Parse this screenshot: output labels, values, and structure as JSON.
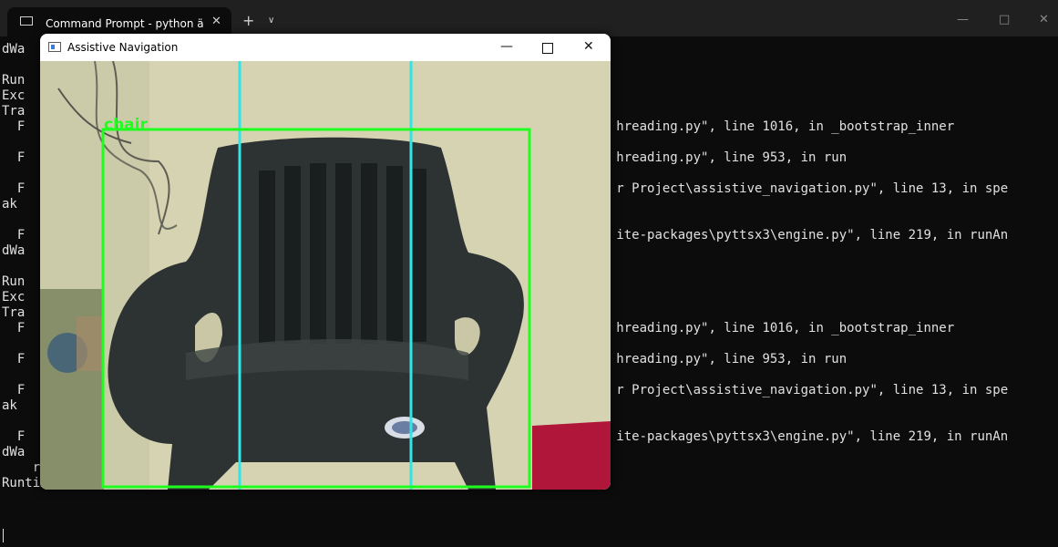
{
  "terminal": {
    "tab_title": "Command Prompt - python  ä",
    "tab_close": "✕",
    "new_tab": "+",
    "tab_dropdown": "∨",
    "minimize": "—",
    "maximize": "□",
    "close": "✕",
    "lines": [
      "dWa",
      "",
      "Run",
      "Exc",
      "Tra",
      "  F                                                                             hreading.py\", line 1016, in _bootstrap_inner",
      "",
      "  F                                                                             hreading.py\", line 953, in run",
      "",
      "  F                                                                             r Project\\assistive_navigation.py\", line 13, in spe",
      "ak",
      "",
      "  F                                                                             ite-packages\\pyttsx3\\engine.py\", line 219, in runAn",
      "dWa",
      "",
      "Run",
      "Exc",
      "Tra",
      "  F                                                                             hreading.py\", line 1016, in _bootstrap_inner",
      "",
      "  F                                                                             hreading.py\", line 953, in run",
      "",
      "  F                                                                             r Project\\assistive_navigation.py\", line 13, in spe",
      "ak",
      "",
      "  F                                                                             ite-packages\\pyttsx3\\engine.py\", line 219, in runAn",
      "dWa",
      "    raise RuntimeError(msg)",
      "RuntimeError: run loop already started"
    ]
  },
  "nav_window": {
    "title": "Assistive Navigation",
    "minimize": "—",
    "close": "✕",
    "detection_label": "chair",
    "colors": {
      "box": "#1dff1d",
      "divider": "#2ee6e6"
    }
  }
}
